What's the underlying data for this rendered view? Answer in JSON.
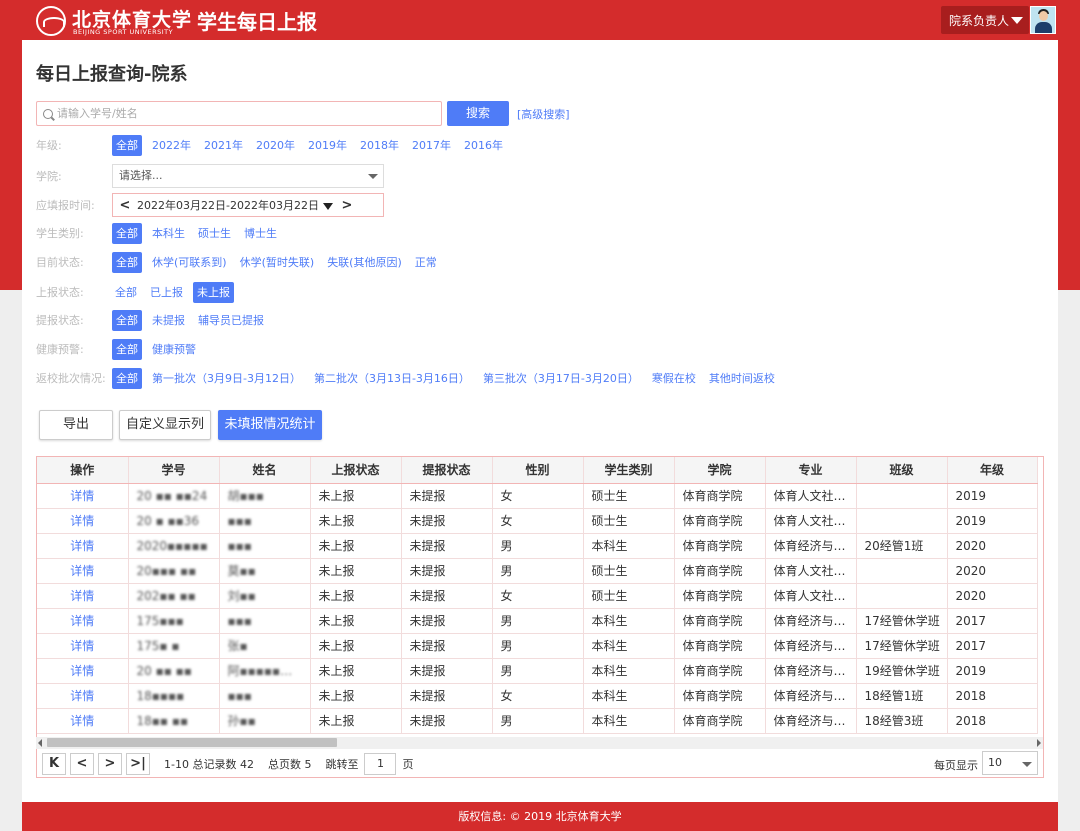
{
  "colors": {
    "brand_red": "#d42c2c",
    "accent_blue": "#4f7cf7"
  },
  "header": {
    "logo_cn": "北京体育大学",
    "logo_en": "BEIJING SPORT UNIVERSITY",
    "app_title": "学生每日上报",
    "user_label": "院系负责人"
  },
  "page": {
    "title": "每日上报查询-院系"
  },
  "search": {
    "placeholder": "请输入学号/姓名",
    "button": "搜索",
    "advanced": "[高级搜索]"
  },
  "filters": {
    "grade": {
      "label": "年级:",
      "options": [
        "全部",
        "2022年",
        "2021年",
        "2020年",
        "2019年",
        "2018年",
        "2017年",
        "2016年"
      ],
      "selected": "全部"
    },
    "college": {
      "label": "学院:",
      "value": "请选择..."
    },
    "date": {
      "label": "应填报时间:",
      "prev": "<",
      "next": ">",
      "value": "2022年03月22日-2022年03月22日"
    },
    "student_type": {
      "label": "学生类别:",
      "options": [
        "全部",
        "本科生",
        "硕士生",
        "博士生"
      ],
      "selected": "全部"
    },
    "status": {
      "label": "目前状态:",
      "options": [
        "全部",
        "休学(可联系到)",
        "休学(暂时失联)",
        "失联(其他原因)",
        "正常"
      ],
      "selected": "全部"
    },
    "report_status": {
      "label": "上报状态:",
      "options": [
        "全部",
        "已上报",
        "未上报"
      ],
      "selected": "未上报"
    },
    "remind_status": {
      "label": "提报状态:",
      "options": [
        "全部",
        "未提报",
        "辅导员已提报"
      ],
      "selected": "全部"
    },
    "health": {
      "label": "健康预警:",
      "options": [
        "全部",
        "健康预警"
      ],
      "selected": "全部"
    },
    "return_batch": {
      "label": "返校批次情况:",
      "options": [
        "全部",
        "第一批次（3月9日-3月12日）",
        "第二批次（3月13日-3月16日）",
        "第三批次（3月17日-3月20日）",
        "寒假在校",
        "其他时间返校"
      ],
      "selected": "全部"
    }
  },
  "actions": {
    "export": "导出",
    "custom_columns": "自定义显示列",
    "unfilled_stats": "未填报情况统计"
  },
  "table": {
    "columns": [
      "操作",
      "学号",
      "姓名",
      "上报状态",
      "提报状态",
      "性别",
      "学生类别",
      "学院",
      "专业",
      "班级",
      "年级"
    ],
    "rows": [
      {
        "op": "详情",
        "id": "20 ▪▪ ▪▪24",
        "name": "胡▪▪▪",
        "report": "未上报",
        "remind": "未提报",
        "gender": "女",
        "type": "硕士生",
        "college": "体育商学院",
        "major": "体育人文社…",
        "class": "",
        "grade": "2019"
      },
      {
        "op": "详情",
        "id": "20 ▪ ▪▪36",
        "name": "▪▪▪",
        "report": "未上报",
        "remind": "未提报",
        "gender": "女",
        "type": "硕士生",
        "college": "体育商学院",
        "major": "体育人文社…",
        "class": "",
        "grade": "2019"
      },
      {
        "op": "详情",
        "id": "2020▪▪▪▪▪",
        "name": "▪▪▪",
        "report": "未上报",
        "remind": "未提报",
        "gender": "男",
        "type": "本科生",
        "college": "体育商学院",
        "major": "体育经济与…",
        "class": "20经管1班",
        "grade": "2020"
      },
      {
        "op": "详情",
        "id": "20▪▪▪ ▪▪",
        "name": "莫▪▪",
        "report": "未上报",
        "remind": "未提报",
        "gender": "男",
        "type": "硕士生",
        "college": "体育商学院",
        "major": "体育人文社…",
        "class": "",
        "grade": "2020"
      },
      {
        "op": "详情",
        "id": "202▪▪ ▪▪",
        "name": "刘▪▪",
        "report": "未上报",
        "remind": "未提报",
        "gender": "女",
        "type": "硕士生",
        "college": "体育商学院",
        "major": "体育人文社…",
        "class": "",
        "grade": "2020"
      },
      {
        "op": "详情",
        "id": "175▪▪▪",
        "name": "▪▪▪",
        "report": "未上报",
        "remind": "未提报",
        "gender": "男",
        "type": "本科生",
        "college": "体育商学院",
        "major": "体育经济与…",
        "class": "17经管休学班",
        "grade": "2017"
      },
      {
        "op": "详情",
        "id": "175▪ ▪",
        "name": "张▪",
        "report": "未上报",
        "remind": "未提报",
        "gender": "男",
        "type": "本科生",
        "college": "体育商学院",
        "major": "体育经济与…",
        "class": "17经管休学班",
        "grade": "2017"
      },
      {
        "op": "详情",
        "id": "20 ▪▪ ▪▪",
        "name": "阿▪▪▪▪▪…",
        "report": "未上报",
        "remind": "未提报",
        "gender": "男",
        "type": "本科生",
        "college": "体育商学院",
        "major": "体育经济与…",
        "class": "19经管休学班",
        "grade": "2019"
      },
      {
        "op": "详情",
        "id": "18▪▪▪▪",
        "name": "▪▪▪",
        "report": "未上报",
        "remind": "未提报",
        "gender": "女",
        "type": "本科生",
        "college": "体育商学院",
        "major": "体育经济与…",
        "class": "18经管1班",
        "grade": "2018"
      },
      {
        "op": "详情",
        "id": "18▪▪ ▪▪",
        "name": "孙▪▪",
        "report": "未上报",
        "remind": "未提报",
        "gender": "男",
        "type": "本科生",
        "college": "体育商学院",
        "major": "体育经济与…",
        "class": "18经管3班",
        "grade": "2018"
      }
    ]
  },
  "pagination": {
    "first": "K",
    "prev": "<",
    "next": ">",
    "last": ">|",
    "summary": "1-10 总记录数 42",
    "total_pages": "总页数 5",
    "jump_label": "跳转至",
    "jump_value": "1",
    "page_unit": "页",
    "page_size_label": "每页显示",
    "page_size": "10"
  },
  "footer": {
    "text": "版权信息: © 2019 北京体育大学"
  }
}
